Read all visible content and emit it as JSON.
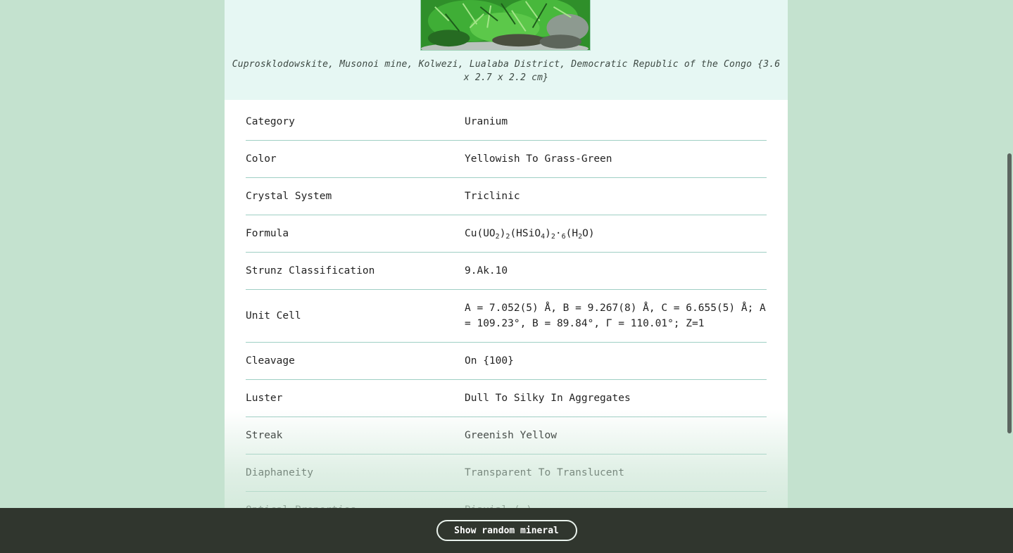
{
  "figure": {
    "caption": "Cuprosklodowskite, Musonoi mine, Kolwezi, Lualaba District, Democratic Republic of the Congo {3.6 x 2.7 x 2.2 cm}"
  },
  "properties": [
    {
      "key": "Category",
      "value": "Uranium"
    },
    {
      "key": "Color",
      "value": "Yellowish To Grass-Green"
    },
    {
      "key": "Crystal System",
      "value": "Triclinic"
    },
    {
      "key": "Formula",
      "value_parts": [
        "Cu(UO",
        "2",
        ")",
        "2",
        "(HSiO",
        "4",
        ")",
        "2",
        "·",
        "6",
        "(H",
        "2",
        "O)"
      ]
    },
    {
      "key": "Strunz Classification",
      "value": "9.Ak.10"
    },
    {
      "key": "Unit Cell",
      "value": "A = 7.052(5) Å, B = 9.267(8) Å, C = 6.655(5) Å; Α = 109.23°, Β = 89.84°, Γ = 110.01°; Z=1"
    },
    {
      "key": "Cleavage",
      "value": "On {100}"
    },
    {
      "key": "Luster",
      "value": "Dull To Silky In Aggregates"
    },
    {
      "key": "Streak",
      "value": "Greenish Yellow"
    },
    {
      "key": "Diaphaneity",
      "value": "Transparent To Translucent"
    },
    {
      "key": "Optical Properties",
      "value": "Biaxial (-)"
    }
  ],
  "actions": {
    "random_label": "Show random mineral"
  },
  "colors": {
    "background": "#c4e2cf",
    "figure_bg": "#e6f7f3",
    "bottom_bar": "#30362e",
    "row_divider": "#9fcfc4"
  },
  "icons": {
    "specimen_photo": "green-mineral-specimen-image"
  }
}
